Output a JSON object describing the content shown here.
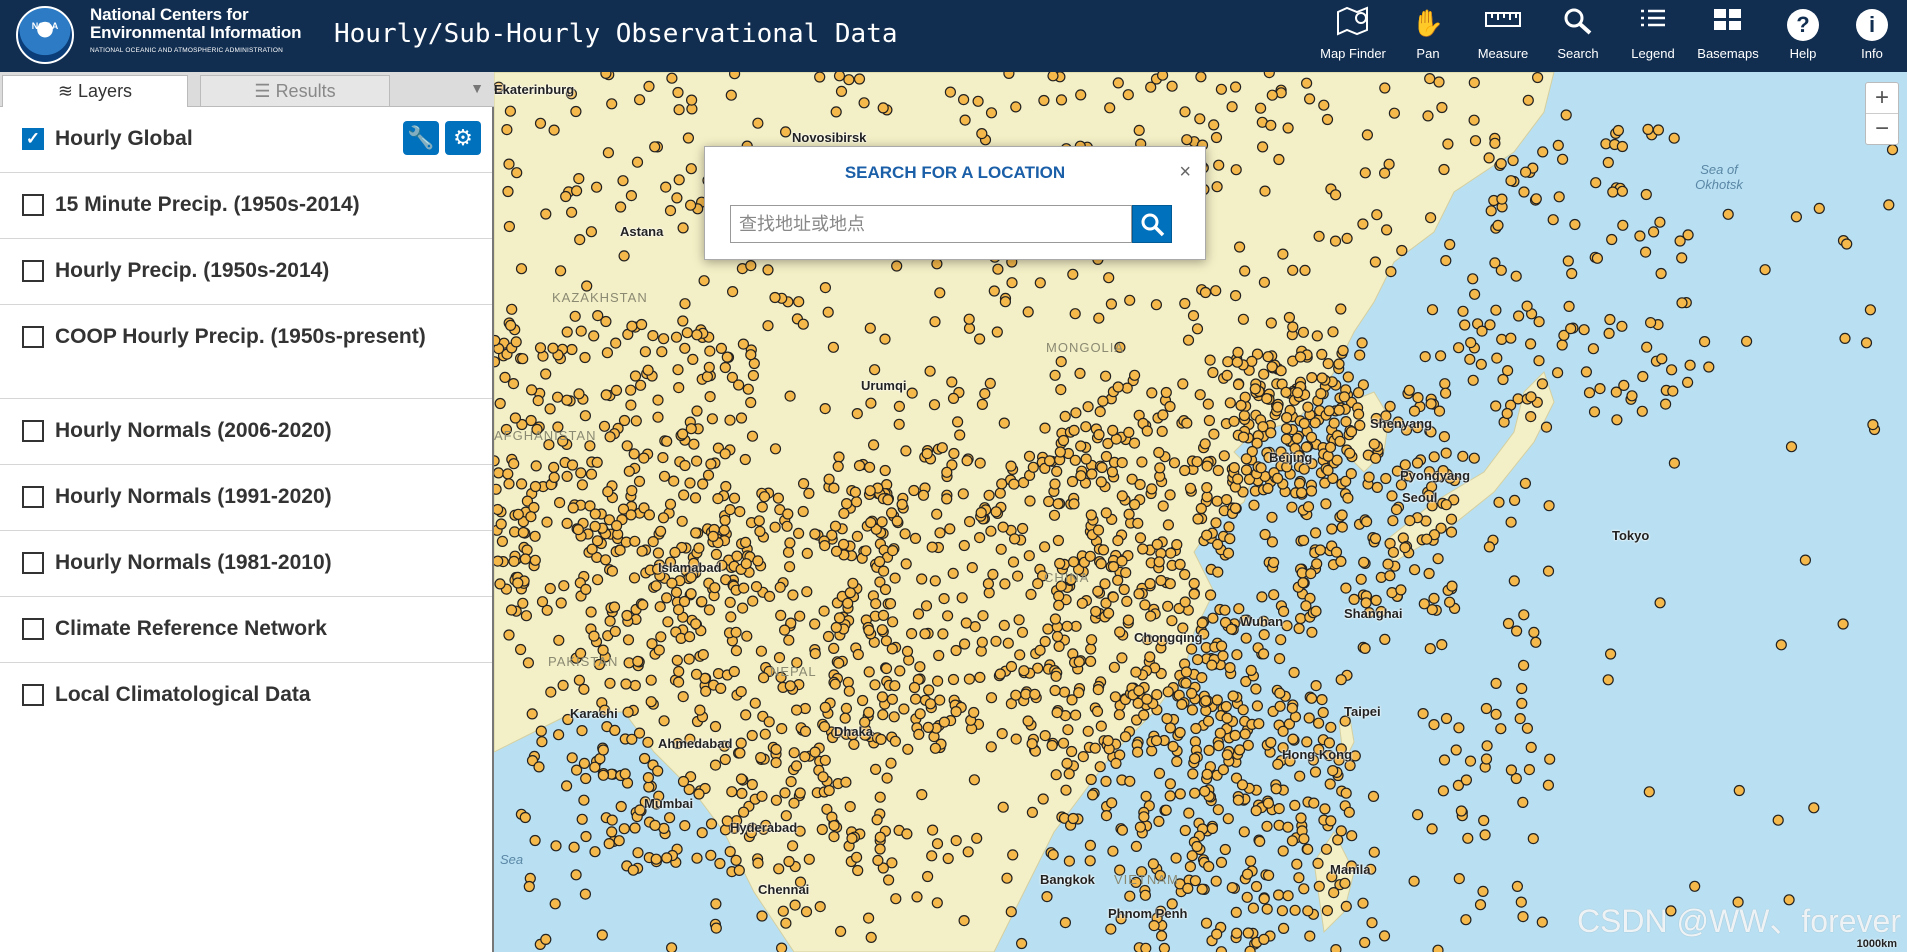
{
  "header": {
    "logo_text": "NOAA",
    "org_line1": "National Centers for",
    "org_line2": "Environmental Information",
    "org_line3": "NATIONAL OCEANIC AND ATMOSPHERIC ADMINISTRATION",
    "app_title": "Hourly/Sub-Hourly Observational Data",
    "tools": [
      {
        "label": "Map Finder",
        "icon": "map-finder-icon"
      },
      {
        "label": "Pan",
        "icon": "hand-icon"
      },
      {
        "label": "Measure",
        "icon": "ruler-icon"
      },
      {
        "label": "Search",
        "icon": "magnifier-icon"
      },
      {
        "label": "Legend",
        "icon": "list-icon"
      },
      {
        "label": "Basemaps",
        "icon": "basemaps-icon"
      },
      {
        "label": "Help",
        "icon": "question-icon"
      },
      {
        "label": "Info",
        "icon": "info-icon"
      }
    ]
  },
  "sidebar": {
    "tabs": [
      {
        "label": "Layers",
        "icon": "layers-icon",
        "active": true
      },
      {
        "label": "Results",
        "icon": "list-icon",
        "active": false
      }
    ],
    "layers": [
      {
        "label": "Hourly Global",
        "checked": true
      },
      {
        "label": "15 Minute Precip. (1950s-2014)",
        "checked": false
      },
      {
        "label": "Hourly Precip. (1950s-2014)",
        "checked": false
      },
      {
        "label": "COOP Hourly Precip. (1950s-present)",
        "checked": false
      },
      {
        "label": "Hourly Normals (2006-2020)",
        "checked": false
      },
      {
        "label": "Hourly Normals (1991-2020)",
        "checked": false
      },
      {
        "label": "Hourly Normals (1981-2010)",
        "checked": false
      },
      {
        "label": "Climate Reference Network",
        "checked": false
      },
      {
        "label": "Local Climatological Data",
        "checked": false
      }
    ]
  },
  "search_dialog": {
    "title": "SEARCH FOR A LOCATION",
    "close": "×",
    "placeholder": "查找地址或地点"
  },
  "map": {
    "places": [
      "Ekaterinburg",
      "Novosibirsk",
      "Astana",
      "Urumqi",
      "Shenyang",
      "Beijing",
      "Pyongyang",
      "Seoul",
      "Tokyo",
      "Shanghai",
      "Wuhan",
      "Chongqing",
      "Taipei",
      "Hong Kong",
      "Karachi",
      "Islamabad",
      "Ahmedabad",
      "Dhaka",
      "Hyderabad",
      "Chennai",
      "Manila",
      "Bangkok",
      "Phnom Penh",
      "Mumbai"
    ],
    "countries": [
      "KAZAKHSTAN",
      "MONGOLIA",
      "CHINA",
      "PAKISTAN",
      "NEPAL",
      "VIETNAM",
      "AFGHANISTAN"
    ],
    "seas": [
      "Sea of Okhotsk",
      "Sea"
    ],
    "zoom_in": "+",
    "zoom_out": "−",
    "scale": "1000km",
    "watermark": "CSDN @WW、forever",
    "colors": {
      "ocean": "#b9e0f2",
      "land": "#f3efc6",
      "station_fill": "#f5b84a",
      "station_stroke": "#222222"
    }
  }
}
